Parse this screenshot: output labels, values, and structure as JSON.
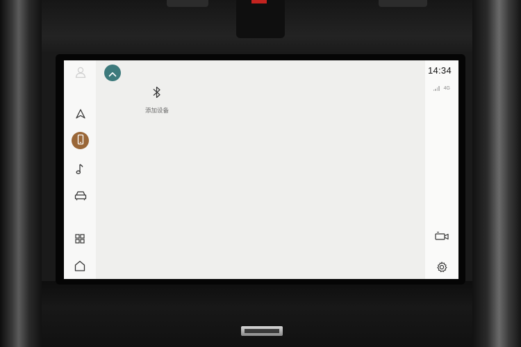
{
  "status_bar": {
    "time": "14:34",
    "network_type": "4G",
    "signal_level": 0.25
  },
  "bluetooth": {
    "icon": "bluetooth-icon",
    "label": "添加设备"
  },
  "left_nav": {
    "items": [
      {
        "name": "profile",
        "icon": "user-icon"
      },
      {
        "name": "navigation",
        "icon": "navigation-arrow-icon"
      },
      {
        "name": "phone",
        "icon": "phone-icon",
        "active": true
      },
      {
        "name": "media",
        "icon": "music-note-icon"
      },
      {
        "name": "vehicle",
        "icon": "car-icon"
      },
      {
        "name": "apps",
        "icon": "apps-grid-icon"
      },
      {
        "name": "home",
        "icon": "home-icon"
      }
    ]
  },
  "right_rail": {
    "items": [
      {
        "name": "camera",
        "icon": "camera-icon"
      },
      {
        "name": "settings",
        "icon": "gear-icon"
      }
    ]
  },
  "colors": {
    "accent_teal": "#3d7a7c",
    "active_bronze": "#9a6738",
    "screen_background": "#efefed"
  }
}
